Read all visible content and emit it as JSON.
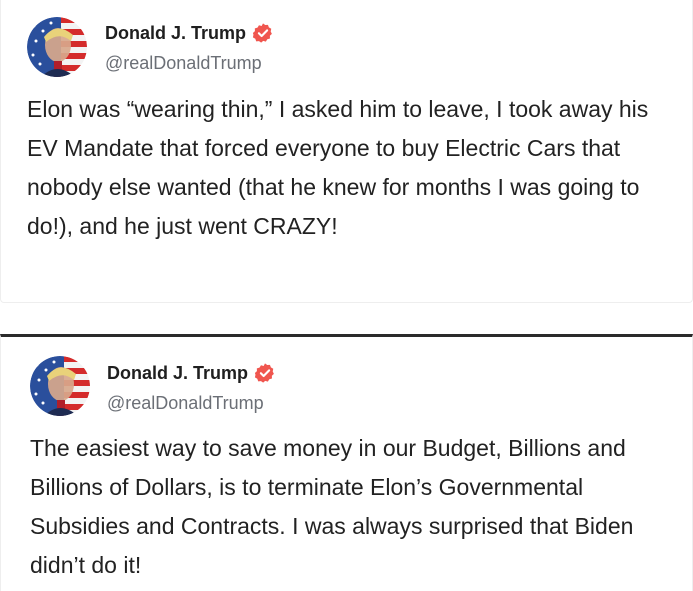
{
  "posts": [
    {
      "author": {
        "display_name": "Donald J. Trump",
        "handle": "@realDonaldTrump",
        "verified": true,
        "avatar_icon": "flag-portrait-avatar"
      },
      "text": "Elon was “wearing thin,” I asked him to leave, I took away his EV Mandate that forced everyone to buy Electric Cars that nobody else wanted (that he knew for months I was going to do!), and he just went CRAZY!"
    },
    {
      "author": {
        "display_name": "Donald J. Trump",
        "handle": "@realDonaldTrump",
        "verified": true,
        "avatar_icon": "flag-portrait-avatar"
      },
      "text": "The easiest way to save money in our Budget, Billions and Billions of Dollars, is to terminate Elon’s Governmental Subsidies and Contracts. I was always surprised that Biden didn’t do it!"
    }
  ],
  "colors": {
    "verified_badge": "#f0564f",
    "name_text": "#1f1f1f",
    "handle_text": "#6b6f76",
    "body_text": "#222222",
    "divider": "#2a2a2a"
  }
}
